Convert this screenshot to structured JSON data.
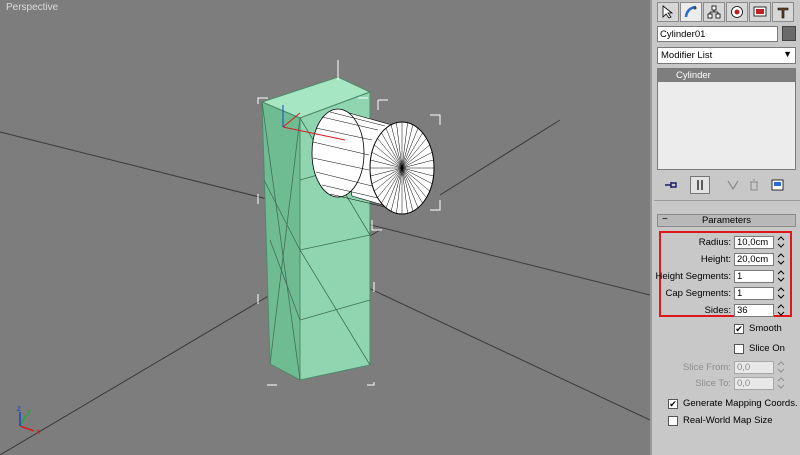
{
  "viewport": {
    "label": "Perspective"
  },
  "command_panel": {
    "tabs": [
      "create-tab-icon",
      "modify-tab-icon",
      "hierarchy-tab-icon",
      "motion-tab-icon",
      "display-tab-icon",
      "utilities-tab-icon"
    ],
    "object_name": "Cylinder01",
    "object_color": "#6a6a6a",
    "modifier_list": {
      "selected": "Modifier List"
    },
    "stack": {
      "items": [
        "Cylinder"
      ]
    },
    "rollout_title": "Parameters",
    "parameters": {
      "radius": {
        "label": "Radius:",
        "value": "10,0cm"
      },
      "height": {
        "label": "Height:",
        "value": "20,0cm"
      },
      "height_segments": {
        "label": "Height Segments:",
        "value": "1"
      },
      "cap_segments": {
        "label": "Cap Segments:",
        "value": "1"
      },
      "sides": {
        "label": "Sides:",
        "value": "36"
      }
    },
    "smooth": {
      "label": "Smooth",
      "checked": true
    },
    "slice_on": {
      "label": "Slice On",
      "checked": false
    },
    "slice_from": {
      "label": "Slice From:",
      "value": "0,0"
    },
    "slice_to": {
      "label": "Slice To:",
      "value": "0,0"
    },
    "generate_mapping": {
      "label": "Generate Mapping Coords.",
      "checked": true
    },
    "real_world": {
      "label": "Real-World Map Size",
      "checked": false
    },
    "highlight_color": "#e0161b"
  },
  "colors": {
    "viewport_bg": "#7d7d7d",
    "object_green": "#8fd6b0",
    "panel_bg": "#c8c8c8"
  }
}
